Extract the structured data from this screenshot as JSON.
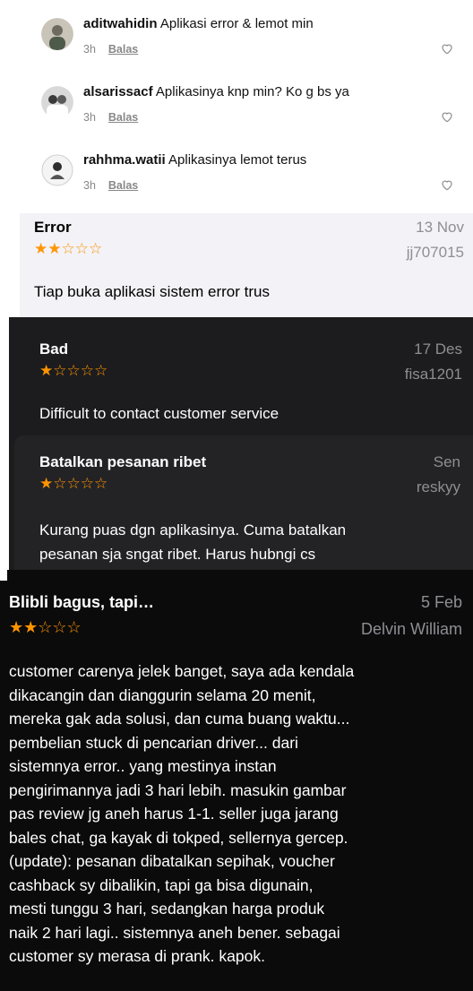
{
  "comments": [
    {
      "username": "aditwahidin",
      "text": "Aplikasi error & lemot min",
      "time": "3h",
      "reply": "Balas"
    },
    {
      "username": "alsarissacf",
      "text": "Aplikasinya knp min? Ko g bs ya",
      "time": "3h",
      "reply": "Balas"
    },
    {
      "username": "rahhma.watii",
      "text": "Aplikasinya lemot terus",
      "time": "3h",
      "reply": "Balas"
    }
  ],
  "reviews": [
    {
      "title": "Error",
      "date": "13 Nov",
      "stars": "★★☆☆☆",
      "author": "jj707015",
      "body": "Tiap buka aplikasi sistem error trus"
    },
    {
      "title": "Bad",
      "date": "17 Des",
      "stars": "★☆☆☆☆",
      "author": "fisa1201",
      "body": "Difficult to contact customer service"
    },
    {
      "title": "Batalkan pesanan ribet",
      "date": "Sen",
      "stars": "★☆☆☆☆",
      "author": "reskyy",
      "body_lines": [
        "Kurang puas dgn aplikasinya. Cuma batalkan",
        "pesanan sja sngat ribet. Harus hubngi cs"
      ]
    },
    {
      "title": "Blibli bagus, tapi…",
      "date": "5 Feb",
      "stars": "★★☆☆☆",
      "author": "Delvin William",
      "body_lines": [
        "customer carenya jelek banget, saya ada kendala",
        "dikacangin dan dianggurin selama 20 menit,",
        "mereka gak ada solusi, dan cuma buang waktu...",
        "pembelian stuck di pencarian driver... dari",
        "sistemnya error.. yang mestinya instan",
        "pengirimannya jadi 3 hari lebih. masukin gambar",
        "pas review jg aneh harus 1-1. seller juga jarang",
        "bales chat, ga kayak di tokped, sellernya gercep.",
        "(update): pesanan dibatalkan sepihak, voucher",
        "cashback sy dibalikin, tapi ga bisa digunain,",
        "mesti tunggu 3 hari, sedangkan harga produk",
        "naik 2 hari lagi.. sistemnya aneh bener. sebagai",
        "customer sy merasa di prank. kapok."
      ]
    }
  ],
  "colors": {
    "star": "#ff9500",
    "dark_bg": "#1c1c1e",
    "light_bg": "#f2f2f7",
    "grey_text": "#8e8e93"
  }
}
